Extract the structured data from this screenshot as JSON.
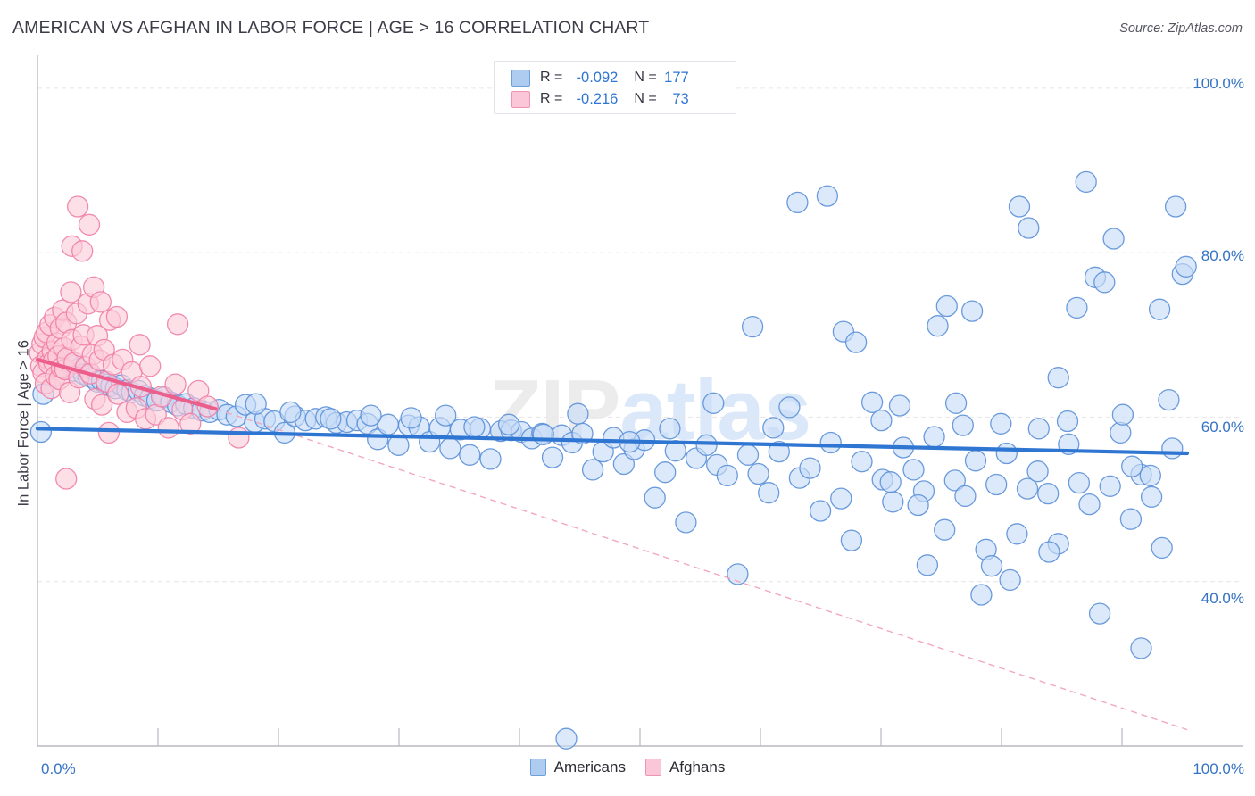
{
  "title": "AMERICAN VS AFGHAN IN LABOR FORCE | AGE > 16 CORRELATION CHART",
  "source": "Source: ZipAtlas.com",
  "watermark": {
    "part1": "ZIP",
    "part2": "atlas"
  },
  "axes": {
    "y_title": "In Labor Force | Age > 16",
    "y_ticks": [
      "100.0%",
      "80.0%",
      "60.0%",
      "40.0%"
    ],
    "x_min_label": "0.0%",
    "x_max_label": "100.0%"
  },
  "stats_legend": {
    "rows": [
      {
        "color": "#aecbf0",
        "r_label": "R =",
        "r_value": "-0.092",
        "n_label": "N =",
        "n_value": "177"
      },
      {
        "color": "#fbc7d8",
        "r_label": "R =",
        "r_value": "-0.216",
        "n_label": "N =",
        "n_value": "73"
      }
    ]
  },
  "series_legend": [
    {
      "name": "Americans",
      "color": "#aecbf0"
    },
    {
      "name": "Afghans",
      "color": "#fbc7d8"
    }
  ],
  "colors": {
    "blue_fill": "#c6dcf7",
    "blue_stroke": "#5b90d8",
    "pink_fill": "#fbcbda",
    "pink_stroke": "#ef7fa6",
    "blue_trend": "#2f76d2",
    "pink_trend": "#ec5e8c",
    "pink_trend_dashed": "#f3a8be",
    "grid": "#e6e6ea",
    "axis": "#b8b8c0",
    "tick_text": "#3573c4"
  },
  "chart_data": {
    "type": "scatter",
    "title": "AMERICAN VS AFGHAN IN LABOR FORCE | AGE > 16 CORRELATION CHART",
    "xlabel": "",
    "ylabel": "In Labor Force | Age > 16",
    "xlim": [
      0,
      100
    ],
    "ylim": [
      20.0,
      104.0
    ],
    "x_ticks": [
      0,
      100
    ],
    "y_ticks": [
      40.0,
      60.0,
      80.0,
      100.0
    ],
    "grid": true,
    "legend_position": "bottom-center",
    "series": [
      {
        "name": "Americans",
        "color": "#c6dcf7",
        "stroke": "#5b90d8",
        "R": -0.092,
        "N": 177,
        "trendline": {
          "style": "solid",
          "color": "#2f76d2",
          "x0": 0.0,
          "y0": 58.6,
          "x1": 100.0,
          "y1": 55.6
        },
        "points": [
          [
            0.3,
            58.2
          ],
          [
            0.5,
            62.8
          ],
          [
            1.2,
            66.3
          ],
          [
            1.6,
            67.0
          ],
          [
            2.0,
            66.1
          ],
          [
            2.4,
            65.8
          ],
          [
            2.8,
            66.4
          ],
          [
            3.2,
            65.6
          ],
          [
            3.6,
            65.9
          ],
          [
            4.0,
            65.2
          ],
          [
            4.4,
            65.0
          ],
          [
            4.8,
            64.8
          ],
          [
            5.2,
            64.3
          ],
          [
            5.6,
            64.4
          ],
          [
            6.0,
            64.0
          ],
          [
            6.4,
            63.8
          ],
          [
            6.8,
            63.5
          ],
          [
            7.3,
            63.9
          ],
          [
            7.8,
            63.3
          ],
          [
            8.2,
            63.0
          ],
          [
            8.8,
            63.2
          ],
          [
            9.3,
            62.6
          ],
          [
            9.8,
            62.3
          ],
          [
            10.4,
            62.0
          ],
          [
            11.0,
            62.4
          ],
          [
            11.6,
            61.8
          ],
          [
            12.2,
            61.4
          ],
          [
            12.9,
            61.6
          ],
          [
            13.6,
            61.1
          ],
          [
            14.3,
            60.8
          ],
          [
            15.0,
            60.6
          ],
          [
            15.8,
            60.9
          ],
          [
            16.5,
            60.3
          ],
          [
            17.3,
            60.1
          ],
          [
            18.1,
            61.5
          ],
          [
            18.9,
            59.4
          ],
          [
            19.8,
            59.8
          ],
          [
            20.6,
            59.5
          ],
          [
            21.5,
            58.1
          ],
          [
            22.4,
            60.1
          ],
          [
            23.3,
            59.6
          ],
          [
            24.2,
            59.8
          ],
          [
            25.1,
            60.0
          ],
          [
            26.0,
            59.3
          ],
          [
            26.9,
            59.4
          ],
          [
            27.8,
            59.6
          ],
          [
            28.7,
            59.2
          ],
          [
            29.6,
            57.3
          ],
          [
            30.5,
            59.1
          ],
          [
            31.4,
            56.6
          ],
          [
            32.3,
            59.0
          ],
          [
            33.2,
            58.8
          ],
          [
            34.1,
            57.0
          ],
          [
            35.0,
            58.7
          ],
          [
            35.9,
            56.2
          ],
          [
            36.8,
            58.5
          ],
          [
            37.6,
            55.4
          ],
          [
            38.5,
            58.6
          ],
          [
            39.4,
            54.9
          ],
          [
            40.3,
            58.3
          ],
          [
            41.2,
            58.4
          ],
          [
            42.1,
            58.2
          ],
          [
            43.0,
            57.4
          ],
          [
            43.9,
            58.0
          ],
          [
            44.8,
            55.1
          ],
          [
            45.6,
            57.8
          ],
          [
            46.5,
            56.9
          ],
          [
            47.4,
            58.0
          ],
          [
            48.3,
            53.6
          ],
          [
            49.2,
            55.8
          ],
          [
            50.1,
            57.5
          ],
          [
            51.0,
            54.3
          ],
          [
            51.9,
            56.1
          ],
          [
            52.8,
            57.2
          ],
          [
            53.7,
            50.2
          ],
          [
            54.6,
            53.3
          ],
          [
            55.5,
            55.9
          ],
          [
            56.4,
            47.2
          ],
          [
            57.3,
            55.0
          ],
          [
            58.2,
            56.6
          ],
          [
            59.1,
            54.2
          ],
          [
            60.0,
            52.9
          ],
          [
            60.9,
            40.9
          ],
          [
            61.8,
            55.4
          ],
          [
            62.7,
            53.1
          ],
          [
            63.6,
            50.8
          ],
          [
            64.5,
            55.8
          ],
          [
            65.4,
            61.2
          ],
          [
            66.3,
            52.6
          ],
          [
            67.2,
            53.8
          ],
          [
            68.1,
            48.6
          ],
          [
            69.0,
            56.9
          ],
          [
            69.9,
            50.1
          ],
          [
            70.8,
            45.0
          ],
          [
            71.7,
            54.6
          ],
          [
            72.6,
            61.8
          ],
          [
            73.5,
            52.4
          ],
          [
            74.4,
            49.7
          ],
          [
            75.3,
            56.3
          ],
          [
            76.2,
            53.6
          ],
          [
            77.1,
            51.0
          ],
          [
            78.0,
            57.6
          ],
          [
            78.9,
            46.3
          ],
          [
            79.8,
            52.3
          ],
          [
            80.7,
            50.4
          ],
          [
            81.6,
            54.7
          ],
          [
            82.5,
            43.9
          ],
          [
            83.4,
            51.8
          ],
          [
            84.3,
            55.6
          ],
          [
            85.2,
            45.8
          ],
          [
            86.1,
            51.3
          ],
          [
            87.0,
            53.4
          ],
          [
            87.9,
            50.7
          ],
          [
            88.8,
            44.6
          ],
          [
            89.7,
            56.7
          ],
          [
            90.6,
            52.0
          ],
          [
            91.5,
            49.4
          ],
          [
            92.4,
            36.1
          ],
          [
            93.3,
            51.6
          ],
          [
            94.2,
            58.1
          ],
          [
            95.1,
            47.6
          ],
          [
            96.0,
            53.0
          ],
          [
            96.9,
            50.3
          ],
          [
            97.8,
            44.1
          ],
          [
            98.7,
            56.2
          ],
          [
            62.2,
            71.0
          ],
          [
            66.1,
            86.1
          ],
          [
            68.7,
            86.9
          ],
          [
            70.1,
            70.4
          ],
          [
            71.2,
            69.1
          ],
          [
            73.4,
            59.6
          ],
          [
            74.2,
            52.1
          ],
          [
            75.0,
            61.4
          ],
          [
            76.6,
            49.3
          ],
          [
            77.4,
            42.0
          ],
          [
            78.3,
            71.1
          ],
          [
            79.1,
            73.5
          ],
          [
            79.9,
            61.7
          ],
          [
            80.5,
            59.0
          ],
          [
            81.3,
            72.9
          ],
          [
            82.1,
            38.4
          ],
          [
            83.0,
            41.9
          ],
          [
            83.8,
            59.2
          ],
          [
            84.6,
            40.2
          ],
          [
            85.4,
            85.6
          ],
          [
            86.2,
            83.0
          ],
          [
            87.1,
            58.6
          ],
          [
            88.0,
            43.6
          ],
          [
            88.8,
            64.8
          ],
          [
            89.6,
            59.5
          ],
          [
            90.4,
            73.3
          ],
          [
            91.2,
            88.6
          ],
          [
            92.0,
            77.0
          ],
          [
            92.8,
            76.4
          ],
          [
            93.6,
            81.7
          ],
          [
            94.4,
            60.3
          ],
          [
            95.2,
            54.0
          ],
          [
            96.0,
            31.9
          ],
          [
            96.8,
            52.9
          ],
          [
            97.6,
            73.1
          ],
          [
            98.4,
            62.1
          ],
          [
            99.0,
            85.6
          ],
          [
            99.6,
            77.4
          ],
          [
            99.9,
            78.3
          ],
          [
            64.0,
            58.7
          ],
          [
            58.8,
            61.7
          ],
          [
            55.0,
            58.6
          ],
          [
            51.5,
            57.0
          ],
          [
            47.0,
            60.4
          ],
          [
            44.0,
            57.9
          ],
          [
            41.0,
            59.1
          ],
          [
            38.0,
            58.8
          ],
          [
            35.5,
            60.2
          ],
          [
            32.5,
            59.9
          ],
          [
            29.0,
            60.2
          ],
          [
            25.5,
            59.8
          ],
          [
            22.0,
            60.6
          ],
          [
            19.0,
            61.6
          ],
          [
            46.0,
            20.9
          ]
        ]
      },
      {
        "name": "Afghans",
        "color": "#fbcbda",
        "stroke": "#ef7fa6",
        "R": -0.216,
        "N": 73,
        "trendline": {
          "style": "solid-then-dashed",
          "color": "#ec5e8c",
          "dashed_color": "#f3a8be",
          "x0": 0.0,
          "y0": 67.0,
          "solid_x1": 15.5,
          "solid_y1": 61.0,
          "x1": 100.0,
          "y1": 22.0
        },
        "points": [
          [
            0.2,
            67.8
          ],
          [
            0.3,
            66.2
          ],
          [
            0.4,
            68.9
          ],
          [
            0.5,
            65.4
          ],
          [
            0.6,
            69.7
          ],
          [
            0.7,
            64.1
          ],
          [
            0.8,
            70.3
          ],
          [
            0.9,
            67.1
          ],
          [
            1.0,
            66.5
          ],
          [
            1.1,
            71.2
          ],
          [
            1.2,
            63.5
          ],
          [
            1.3,
            68.0
          ],
          [
            1.4,
            66.8
          ],
          [
            1.5,
            72.1
          ],
          [
            1.6,
            65.0
          ],
          [
            1.7,
            69.0
          ],
          [
            1.8,
            67.4
          ],
          [
            1.9,
            64.6
          ],
          [
            2.0,
            70.8
          ],
          [
            2.1,
            66.0
          ],
          [
            2.2,
            73.0
          ],
          [
            2.3,
            68.4
          ],
          [
            2.4,
            65.8
          ],
          [
            2.5,
            71.5
          ],
          [
            2.6,
            67.2
          ],
          [
            2.8,
            63.0
          ],
          [
            3.0,
            69.4
          ],
          [
            3.2,
            66.6
          ],
          [
            3.4,
            72.6
          ],
          [
            3.6,
            64.8
          ],
          [
            3.8,
            68.6
          ],
          [
            4.0,
            70.0
          ],
          [
            4.2,
            66.1
          ],
          [
            4.4,
            73.8
          ],
          [
            4.6,
            65.3
          ],
          [
            4.8,
            67.6
          ],
          [
            5.0,
            62.2
          ],
          [
            5.2,
            69.9
          ],
          [
            5.4,
            66.9
          ],
          [
            5.6,
            61.5
          ],
          [
            5.8,
            68.2
          ],
          [
            6.0,
            64.3
          ],
          [
            6.3,
            71.8
          ],
          [
            6.6,
            66.4
          ],
          [
            7.0,
            62.8
          ],
          [
            7.4,
            67.0
          ],
          [
            7.8,
            60.6
          ],
          [
            8.2,
            65.5
          ],
          [
            8.6,
            61.1
          ],
          [
            9.0,
            63.7
          ],
          [
            9.4,
            59.8
          ],
          [
            9.8,
            66.2
          ],
          [
            10.3,
            60.3
          ],
          [
            10.8,
            62.5
          ],
          [
            11.4,
            58.7
          ],
          [
            12.0,
            64.0
          ],
          [
            12.6,
            60.9
          ],
          [
            13.3,
            59.2
          ],
          [
            14.0,
            63.2
          ],
          [
            14.8,
            61.3
          ],
          [
            3.5,
            85.6
          ],
          [
            4.5,
            83.4
          ],
          [
            3.0,
            80.8
          ],
          [
            3.9,
            80.2
          ],
          [
            12.2,
            71.3
          ],
          [
            2.5,
            52.5
          ],
          [
            6.2,
            58.1
          ],
          [
            17.5,
            57.5
          ],
          [
            4.9,
            75.8
          ],
          [
            2.9,
            75.2
          ],
          [
            5.5,
            74.0
          ],
          [
            6.9,
            72.2
          ],
          [
            8.9,
            68.8
          ]
        ]
      }
    ]
  }
}
